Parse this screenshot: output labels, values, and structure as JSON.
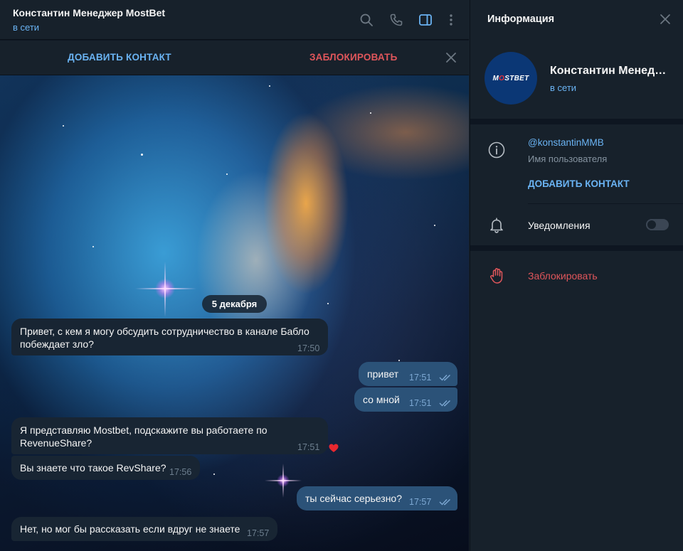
{
  "chat": {
    "title": "Константин Менеджер MostBet",
    "status": "в сети",
    "header_icons": [
      "search-icon",
      "phone-icon",
      "sidebar-toggle-icon",
      "more-vertical-icon"
    ]
  },
  "action_bar": {
    "add_contact": "ДОБАВИТЬ КОНТАКТ",
    "block": "ЗАБЛОКИРОВАТЬ"
  },
  "date_separator": "5 декабря",
  "messages": [
    {
      "direction": "in",
      "lines": [
        "Привет, с кем я могу обсудить сотрудничество в канале Бабло",
        "побеждает зло?"
      ],
      "time": "17:50"
    },
    {
      "direction": "out",
      "lines": [
        "привет"
      ],
      "time": "17:51",
      "read": true
    },
    {
      "direction": "out",
      "lines": [
        "со мной"
      ],
      "time": "17:51",
      "read": true
    },
    {
      "direction": "in",
      "lines": [
        "Я представляю Mostbet, подскажите вы работаете по",
        "RevenueShare?"
      ],
      "time": "17:51",
      "reaction": "heart"
    },
    {
      "direction": "in",
      "lines": [
        "Вы знаете что такое RevShare?"
      ],
      "time": "17:56"
    },
    {
      "direction": "out",
      "lines": [
        "ты сейчас серьезно?"
      ],
      "time": "17:57",
      "read": true
    },
    {
      "direction": "in",
      "lines": [
        "Нет, но мог бы рассказать если вдруг не знаете"
      ],
      "time": "17:57"
    }
  ],
  "info_panel": {
    "title": "Информация",
    "avatar_logo": "MOSTBET",
    "name": "Константин Менеджер MostBet",
    "status": "в сети",
    "username": "@konstantinMMB",
    "username_label": "Имя пользователя",
    "add_contact": "ДОБАВИТЬ КОНТАКТ",
    "notifications_label": "Уведомления",
    "notifications_enabled": false,
    "block_label": "Заблокировать"
  },
  "colors": {
    "panel_bg": "#17212b",
    "chat_bg": "#0e1621",
    "incoming_bubble": "#182533",
    "outgoing_bubble": "#2b5278",
    "accent_blue": "#6ab3f3",
    "danger_red": "#e0565b"
  }
}
